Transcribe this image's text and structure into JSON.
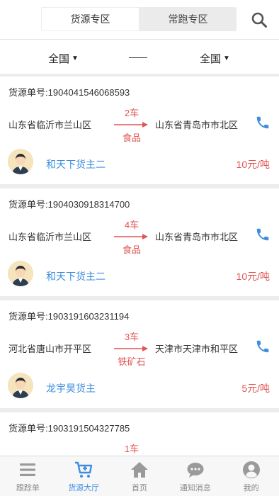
{
  "header": {
    "tabs": [
      {
        "label": "货源专区",
        "active": true
      },
      {
        "label": "常跑专区",
        "active": false
      }
    ],
    "search_icon": "search-icon"
  },
  "filter": {
    "from": "全国",
    "to": "全国"
  },
  "orders": [
    {
      "order_no": "货源单号:1904041546068593",
      "from": "山东省临沂市兰山区",
      "to": "山东省青岛市市北区",
      "qty": "2车",
      "cargo": "食品",
      "owner": "和天下货主二",
      "price": "10元/吨"
    },
    {
      "order_no": "货源单号:1904030918314700",
      "from": "山东省临沂市兰山区",
      "to": "山东省青岛市市北区",
      "qty": "4车",
      "cargo": "食品",
      "owner": "和天下货主二",
      "price": "10元/吨"
    },
    {
      "order_no": "货源单号:1903191603231194",
      "from": "河北省唐山市开平区",
      "to": "天津市天津市和平区",
      "qty": "3车",
      "cargo": "铁矿石",
      "owner": "龙宇昊货主",
      "price": "5元/吨"
    },
    {
      "order_no": "货源单号:1903191504327785",
      "qty": "1车"
    }
  ],
  "tabbar": [
    {
      "label": "跟踪单",
      "icon": "menu-icon",
      "active": false
    },
    {
      "label": "货源大厅",
      "icon": "cart-plus-icon",
      "active": true
    },
    {
      "label": "首页",
      "icon": "home-icon",
      "active": false
    },
    {
      "label": "通知消息",
      "icon": "chat-icon",
      "active": false
    },
    {
      "label": "我的",
      "icon": "user-icon",
      "active": false
    }
  ],
  "colors": {
    "accent": "#3d8ee0",
    "price": "#e05552",
    "nav_inactive": "#9a9a9a"
  }
}
